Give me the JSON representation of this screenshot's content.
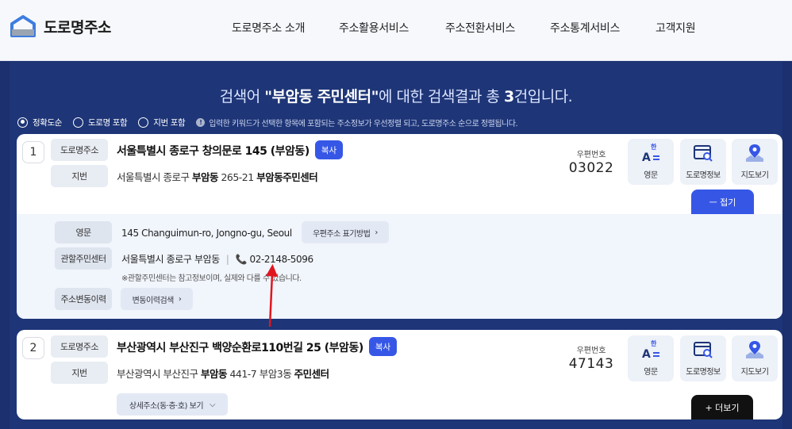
{
  "header": {
    "logo_text": "도로명주소",
    "nav": [
      "도로명주소 소개",
      "주소활용서비스",
      "주소전환서비스",
      "주소통계서비스",
      "고객지원"
    ]
  },
  "search": {
    "prefix": "검색어 ",
    "keyword": "\"부암동 주민센터\"",
    "middle": "에 대한 검색결과 총 ",
    "count": "3",
    "suffix": "건입니다."
  },
  "options": {
    "radios": [
      {
        "label": "정확도순",
        "selected": true
      },
      {
        "label": "도로명 포함",
        "selected": false
      },
      {
        "label": "지번 포함",
        "selected": false
      }
    ],
    "info_icon": "!",
    "info": "입력한 키워드가 선택한 항목에 포함되는 주소정보가 우선정렬 되고, 도로명주소 순으로 정렬됩니다."
  },
  "labels": {
    "road": "도로명주소",
    "jibun": "지번",
    "copy": "복사",
    "zip": "우편번호",
    "english": "영문",
    "road_info": "도로명정보",
    "map": "지도보기",
    "eng_icon_text": "한",
    "eng_icon_letter": "A"
  },
  "results": [
    {
      "no": "1",
      "road_address": "서울특별시 종로구 창의문로 145 (부암동)",
      "jibun_pre": "서울특별시 종로구 ",
      "jibun_bold": "부암동",
      "jibun_mid": " 265-21 ",
      "jibun_bold2": "부암동주민센터",
      "zip": "03022",
      "toggle": "ㅡ  접기",
      "detail": {
        "english_label": "영문",
        "english": "145 Changuimun-ro, Jongno-gu, Seoul",
        "english_link": "우편주소 표기방법",
        "center_label": "관할주민센터",
        "center": "서울특별시 종로구 부암동",
        "phone": "02-2148-5096",
        "note": "※관할주민센터는 참고정보이며, 실제와 다를 수 있습니다.",
        "history_label": "주소변동이력",
        "history_link": "변동이력검색"
      }
    },
    {
      "no": "2",
      "road_address": "부산광역시 부산진구 백양순환로110번길 25 (부암동)",
      "jibun_pre": "부산광역시 부산진구 ",
      "jibun_bold": "부암동",
      "jibun_mid": " 441-7 부암3동 ",
      "jibun_bold2": "주민센터",
      "zip": "47143",
      "detail_link": "상세주소(동·층·호) 보기",
      "toggle": "+  더보기"
    }
  ],
  "colors": {
    "accent": "#3657e6",
    "panel": "#1e3577",
    "annotation": "#e0161e"
  }
}
